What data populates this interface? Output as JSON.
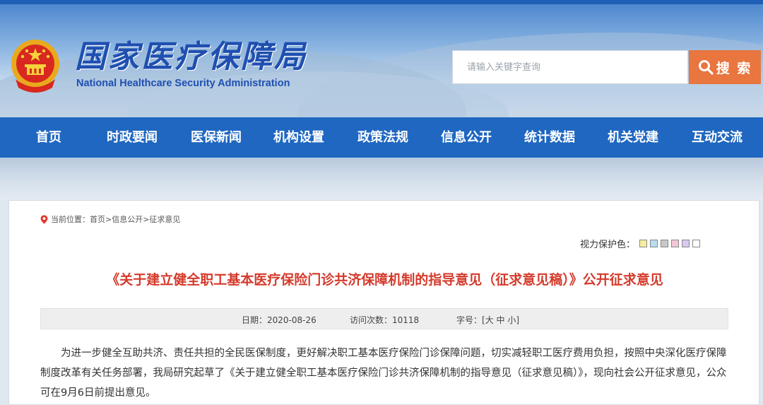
{
  "site": {
    "title": "国家医疗保障局",
    "subtitle": "National Healthcare Security Administration"
  },
  "search": {
    "placeholder": "请输入关键字查询",
    "button_label": "搜 索"
  },
  "nav": {
    "items": [
      "首页",
      "时政要闻",
      "医保新闻",
      "机构设置",
      "政策法规",
      "信息公开",
      "统计数据",
      "机关党建",
      "互动交流"
    ]
  },
  "breadcrumb": {
    "text": "当前位置：首页>信息公开>征求意见"
  },
  "vision": {
    "label": "视力保护色：",
    "swatches": [
      "#f5eea0",
      "#b9dcf0",
      "#c8c8c8",
      "#f3c6d9",
      "#d7c9ef",
      "#ffffff"
    ]
  },
  "article": {
    "title": "《关于建立健全职工基本医疗保险门诊共济保障机制的指导意见（征求意见稿）》公开征求意见",
    "meta": {
      "date_label": "日期：",
      "date": "2020-08-26",
      "visits_label": "访问次数：",
      "visits": "10118",
      "font_label": "字号：[",
      "font_large": "大",
      "font_medium": "中",
      "font_small": "小",
      "font_end": "]"
    },
    "body": "为进一步健全互助共济、责任共担的全民医保制度，更好解决职工基本医疗保险门诊保障问题，切实减轻职工医疗费用负担，按照中央深化医疗保障制度改革有关任务部署，我局研究起草了《关于建立健全职工基本医疗保险门诊共济保障机制的指导意见（征求意见稿）》，现向社会公开征求意见，公众可在9月6日前提出意见。"
  }
}
